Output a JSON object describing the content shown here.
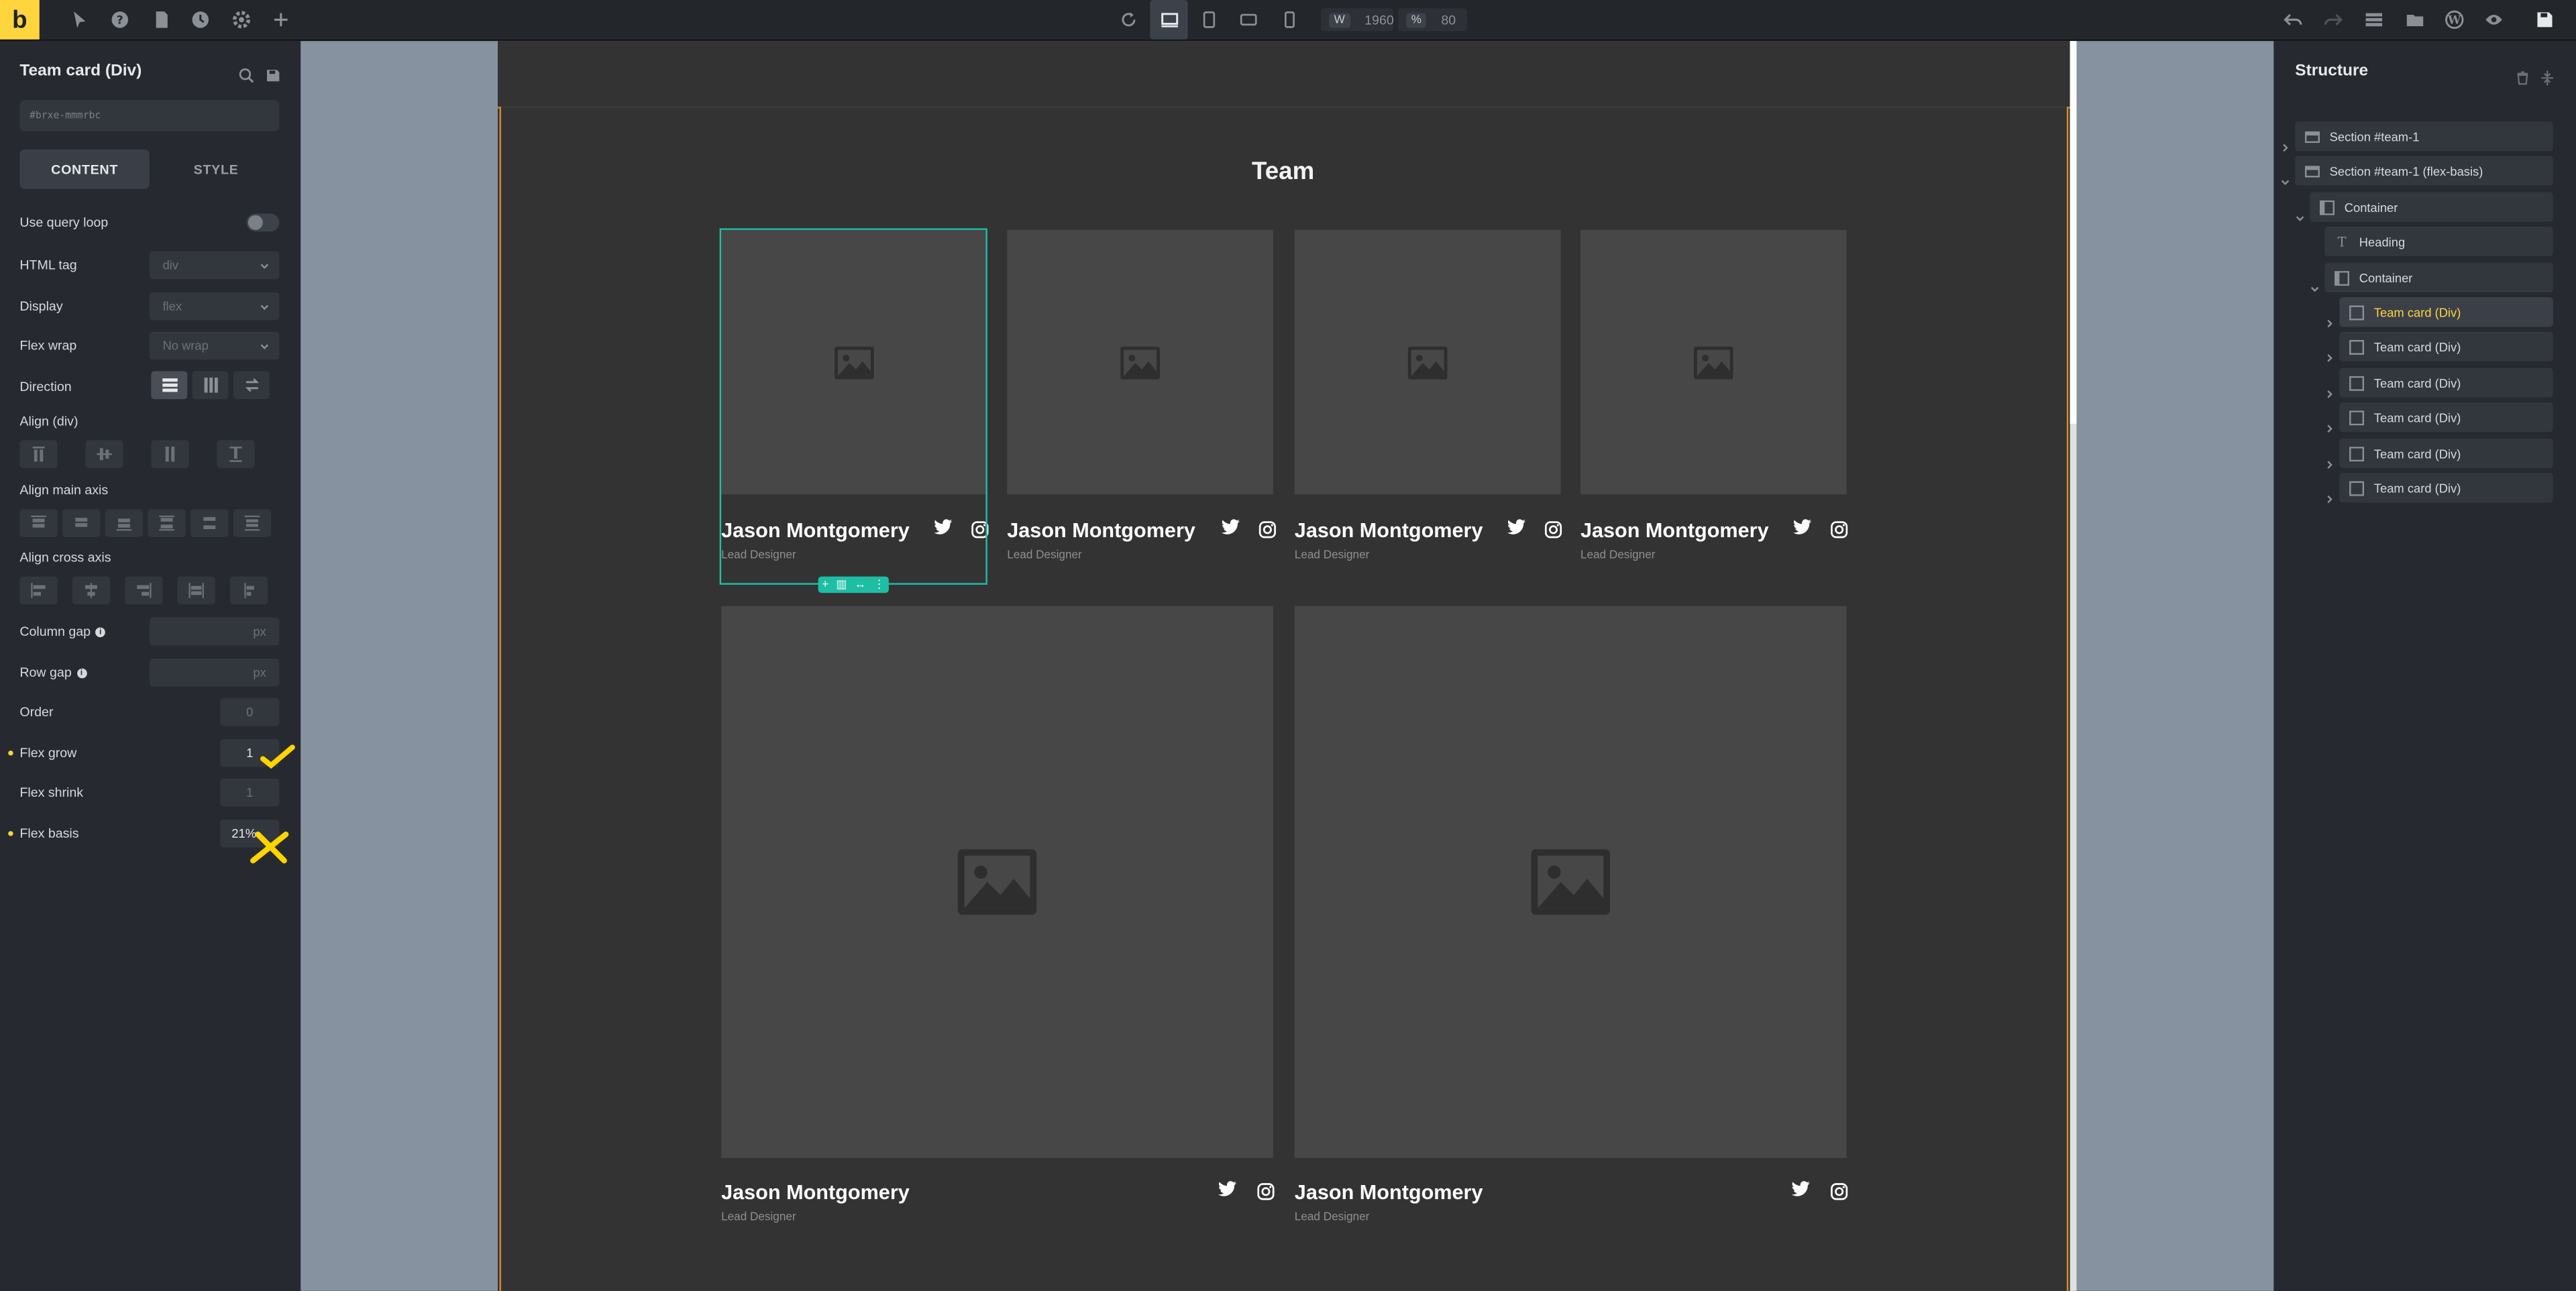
{
  "topbar": {
    "logo": "b",
    "width_label": "W",
    "width_value": "1960",
    "zoom_label": "%",
    "zoom_value": "80"
  },
  "left_panel": {
    "title": "Team card (Div)",
    "css_id": "#brxe-mmmrbc",
    "tabs": {
      "content": "CONTENT",
      "style": "STYLE"
    },
    "use_query_loop": "Use query loop",
    "html_tag": {
      "label": "HTML tag",
      "value": "div"
    },
    "display": {
      "label": "Display",
      "value": "flex"
    },
    "flex_wrap": {
      "label": "Flex wrap",
      "value": "No wrap"
    },
    "direction": {
      "label": "Direction"
    },
    "align_div": {
      "label": "Align (div)"
    },
    "align_main": {
      "label": "Align main axis"
    },
    "align_cross": {
      "label": "Align cross axis"
    },
    "column_gap": {
      "label": "Column gap",
      "unit": "px"
    },
    "row_gap": {
      "label": "Row gap",
      "unit": "px"
    },
    "order": {
      "label": "Order",
      "value": "0"
    },
    "flex_grow": {
      "label": "Flex grow",
      "value": "1"
    },
    "flex_shrink": {
      "label": "Flex shrink",
      "value": "1"
    },
    "flex_basis": {
      "label": "Flex basis",
      "value": "21%"
    }
  },
  "page": {
    "heading": "Team",
    "cards": [
      {
        "name": "Jason Montgomery",
        "role": "Lead Designer"
      },
      {
        "name": "Jason Montgomery",
        "role": "Lead Designer"
      },
      {
        "name": "Jason Montgomery",
        "role": "Lead Designer"
      },
      {
        "name": "Jason Montgomery",
        "role": "Lead Designer"
      },
      {
        "name": "Jason Montgomery",
        "role": "Lead Designer"
      },
      {
        "name": "Jason Montgomery",
        "role": "Lead Designer"
      }
    ]
  },
  "structure": {
    "title": "Structure",
    "items": [
      {
        "label": "Section #team-1"
      },
      {
        "label": "Section #team-1 (flex-basis)"
      },
      {
        "label": "Container"
      },
      {
        "label": "Heading"
      },
      {
        "label": "Container"
      },
      {
        "label": "Team card (Div)"
      },
      {
        "label": "Team card (Div)"
      },
      {
        "label": "Team card (Div)"
      },
      {
        "label": "Team card (Div)"
      },
      {
        "label": "Team card (Div)"
      },
      {
        "label": "Team card (Div)"
      }
    ]
  },
  "colors": {
    "accent": "#ffd53e",
    "selection": "#1ebea5",
    "section_outline": "#d88b2a",
    "annotation_marks": "#ffd400"
  }
}
